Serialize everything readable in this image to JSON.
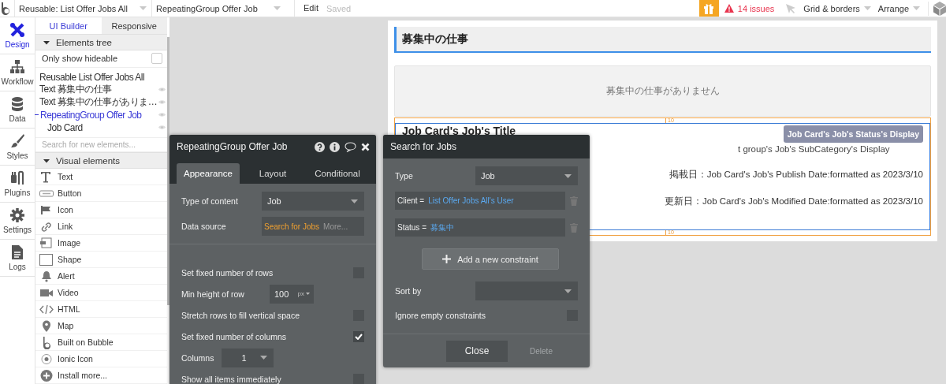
{
  "top_bar": {
    "selectors": [
      {
        "value": "Reusable: List Offer Jobs All"
      },
      {
        "value": "RepeatingGroup Offer Job"
      }
    ],
    "edit_menu": "Edit",
    "save_status": "Saved",
    "issues": "14 issues",
    "grid_menu": "Grid & borders",
    "arrange_menu": "Arrange"
  },
  "rail": [
    {
      "label": "Design",
      "kind": "design",
      "selected": true
    },
    {
      "label": "Workflow",
      "kind": "workflow",
      "selected": false
    },
    {
      "label": "Data",
      "kind": "data",
      "selected": false
    },
    {
      "label": "Styles",
      "kind": "styles",
      "selected": false
    },
    {
      "label": "Plugins",
      "kind": "plugins",
      "selected": false
    },
    {
      "label": "Settings",
      "kind": "settings",
      "selected": false
    },
    {
      "label": "Logs",
      "kind": "logs",
      "selected": false
    }
  ],
  "panel": {
    "tabs": [
      {
        "label": "UI Builder",
        "selected": true
      },
      {
        "label": "Responsive",
        "selected": false
      }
    ],
    "elements_tree": {
      "title": "Elements tree",
      "expanded": true,
      "filter": {
        "label": "Only show hideable",
        "checked": false
      },
      "items": [
        {
          "label": "Reusable List Offer Jobs All",
          "selected": false,
          "children": [
            {
              "label": "Text 募集中の仕事",
              "selected": false
            },
            {
              "label": "Text 募集中の仕事がありま…",
              "selected": false
            },
            {
              "label": "RepeatingGroup Offer Job",
              "selected": true,
              "children": [
                {
                  "label": "Job Card",
                  "selected": false
                }
              ]
            }
          ]
        }
      ]
    },
    "search": {
      "placeholder": "Search for new elements..."
    },
    "visual_elements": {
      "title": "Visual elements",
      "expanded": true,
      "items": [
        {
          "label": "Text",
          "kind": "text"
        },
        {
          "label": "Button",
          "kind": "button"
        },
        {
          "label": "Icon",
          "kind": "icon"
        },
        {
          "label": "Link",
          "kind": "link"
        },
        {
          "label": "Image",
          "kind": "image"
        },
        {
          "label": "Shape",
          "kind": "shape"
        },
        {
          "label": "Alert",
          "kind": "alert"
        },
        {
          "label": "Video",
          "kind": "video"
        },
        {
          "label": "HTML",
          "kind": "html"
        },
        {
          "label": "Map",
          "kind": "map"
        },
        {
          "label": "Built on Bubble",
          "kind": "bubble"
        },
        {
          "label": "Ionic Icon",
          "kind": "ionic"
        },
        {
          "label": "Install more...",
          "kind": "install"
        }
      ]
    }
  },
  "canvas": {
    "section_title": "募集中の仕事",
    "empty_message": "募集中の仕事がありません",
    "spacing_labels": [
      "10",
      "10"
    ],
    "job_card": {
      "title": "Job Card's Job's Title",
      "status_badge": "Job Card's Job's Status's Display",
      "subcategory": "t group's Job's SubCategory's Display",
      "publish_date": "掲載日：Job Card's Job's Publish Date:formatted as 2023/3/10",
      "modified_date": "更新日：Job Card's Job's Modified Date:formatted as 2023/3/10"
    }
  },
  "property_editor": {
    "title": "RepeatingGroup Offer Job",
    "tabs": [
      {
        "label": "Appearance",
        "selected": true
      },
      {
        "label": "Layout",
        "selected": false
      },
      {
        "label": "Conditional",
        "selected": false
      }
    ],
    "type_of_content": {
      "label": "Type of content",
      "value": "Job"
    },
    "data_source": {
      "label": "Data source",
      "value": "Search for Jobs",
      "more": "More..."
    },
    "settings": [
      {
        "kind": "checkbox",
        "label": "Set fixed number of rows",
        "checked": false
      },
      {
        "kind": "number",
        "label": "Min height of row",
        "value": "100",
        "unit": "px"
      },
      {
        "kind": "checkbox",
        "label": "Stretch rows to fill vertical space",
        "checked": false
      },
      {
        "kind": "checkbox",
        "label": "Set fixed number of columns",
        "checked": true
      },
      {
        "kind": "select",
        "label": "Columns",
        "value": "1"
      },
      {
        "kind": "checkbox",
        "label": "Show all items immediately",
        "checked": false
      }
    ]
  },
  "search_editor": {
    "title": "Search for Jobs",
    "type": {
      "label": "Type",
      "value": "Job"
    },
    "constraints": [
      {
        "field": "Client =",
        "value": "List Offer Jobs All's User"
      },
      {
        "field": "Status =",
        "value": "募集中"
      }
    ],
    "add_button": "Add a new constraint",
    "sort_by": {
      "label": "Sort by"
    },
    "ignore_empty": {
      "label": "Ignore empty constraints",
      "checked": false
    },
    "close_button": "Close",
    "delete_button": {
      "label": "Delete",
      "disabled": true
    }
  }
}
